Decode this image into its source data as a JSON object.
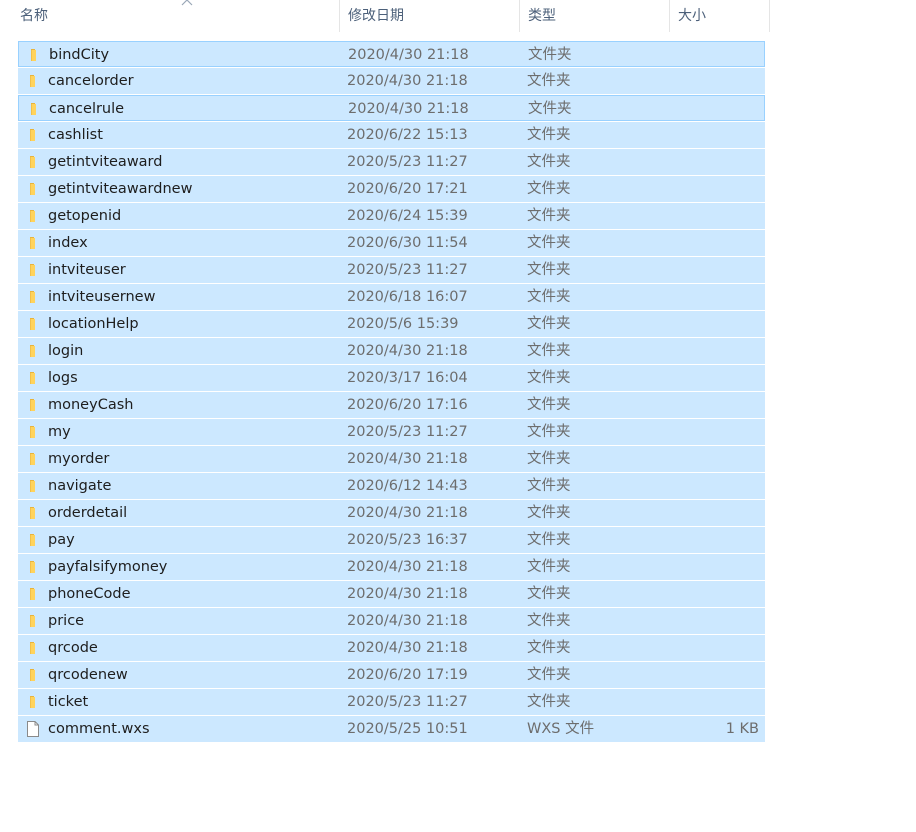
{
  "headers": {
    "name": "名称",
    "modified": "修改日期",
    "type": "类型",
    "size": "大小"
  },
  "colors": {
    "selected_bg": "#cce8ff",
    "selected_border": "#99d1ff",
    "folder_yellow": "#ffd35c",
    "header_text": "#4c607a"
  },
  "rows": [
    {
      "name": "bindCity",
      "date": "2020/4/30 21:18",
      "type": "文件夹",
      "size": "",
      "icon": "folder-icon"
    },
    {
      "name": "cancelorder",
      "date": "2020/4/30 21:18",
      "type": "文件夹",
      "size": "",
      "icon": "folder-icon"
    },
    {
      "name": "cancelrule",
      "date": "2020/4/30 21:18",
      "type": "文件夹",
      "size": "",
      "icon": "folder-icon"
    },
    {
      "name": "cashlist",
      "date": "2020/6/22 15:13",
      "type": "文件夹",
      "size": "",
      "icon": "folder-icon"
    },
    {
      "name": "getintviteaward",
      "date": "2020/5/23 11:27",
      "type": "文件夹",
      "size": "",
      "icon": "folder-icon"
    },
    {
      "name": "getintviteawardnew",
      "date": "2020/6/20 17:21",
      "type": "文件夹",
      "size": "",
      "icon": "folder-icon"
    },
    {
      "name": "getopenid",
      "date": "2020/6/24 15:39",
      "type": "文件夹",
      "size": "",
      "icon": "folder-icon"
    },
    {
      "name": "index",
      "date": "2020/6/30 11:54",
      "type": "文件夹",
      "size": "",
      "icon": "folder-icon"
    },
    {
      "name": "intviteuser",
      "date": "2020/5/23 11:27",
      "type": "文件夹",
      "size": "",
      "icon": "folder-icon"
    },
    {
      "name": "intviteusernew",
      "date": "2020/6/18 16:07",
      "type": "文件夹",
      "size": "",
      "icon": "folder-icon"
    },
    {
      "name": "locationHelp",
      "date": "2020/5/6 15:39",
      "type": "文件夹",
      "size": "",
      "icon": "folder-icon"
    },
    {
      "name": "login",
      "date": "2020/4/30 21:18",
      "type": "文件夹",
      "size": "",
      "icon": "folder-icon"
    },
    {
      "name": "logs",
      "date": "2020/3/17 16:04",
      "type": "文件夹",
      "size": "",
      "icon": "folder-icon"
    },
    {
      "name": "moneyCash",
      "date": "2020/6/20 17:16",
      "type": "文件夹",
      "size": "",
      "icon": "folder-icon"
    },
    {
      "name": "my",
      "date": "2020/5/23 11:27",
      "type": "文件夹",
      "size": "",
      "icon": "folder-icon"
    },
    {
      "name": "myorder",
      "date": "2020/4/30 21:18",
      "type": "文件夹",
      "size": "",
      "icon": "folder-icon"
    },
    {
      "name": "navigate",
      "date": "2020/6/12 14:43",
      "type": "文件夹",
      "size": "",
      "icon": "folder-icon"
    },
    {
      "name": "orderdetail",
      "date": "2020/4/30 21:18",
      "type": "文件夹",
      "size": "",
      "icon": "folder-icon"
    },
    {
      "name": "pay",
      "date": "2020/5/23 16:37",
      "type": "文件夹",
      "size": "",
      "icon": "folder-icon"
    },
    {
      "name": "payfalsifymoney",
      "date": "2020/4/30 21:18",
      "type": "文件夹",
      "size": "",
      "icon": "folder-icon"
    },
    {
      "name": "phoneCode",
      "date": "2020/4/30 21:18",
      "type": "文件夹",
      "size": "",
      "icon": "folder-icon"
    },
    {
      "name": "price",
      "date": "2020/4/30 21:18",
      "type": "文件夹",
      "size": "",
      "icon": "folder-icon"
    },
    {
      "name": "qrcode",
      "date": "2020/4/30 21:18",
      "type": "文件夹",
      "size": "",
      "icon": "folder-icon"
    },
    {
      "name": "qrcodenew",
      "date": "2020/6/20 17:19",
      "type": "文件夹",
      "size": "",
      "icon": "folder-icon"
    },
    {
      "name": "ticket",
      "date": "2020/5/23 11:27",
      "type": "文件夹",
      "size": "",
      "icon": "folder-icon"
    },
    {
      "name": "comment.wxs",
      "date": "2020/5/25 10:51",
      "type": "WXS 文件",
      "size": "1 KB",
      "icon": "file-icon"
    }
  ]
}
